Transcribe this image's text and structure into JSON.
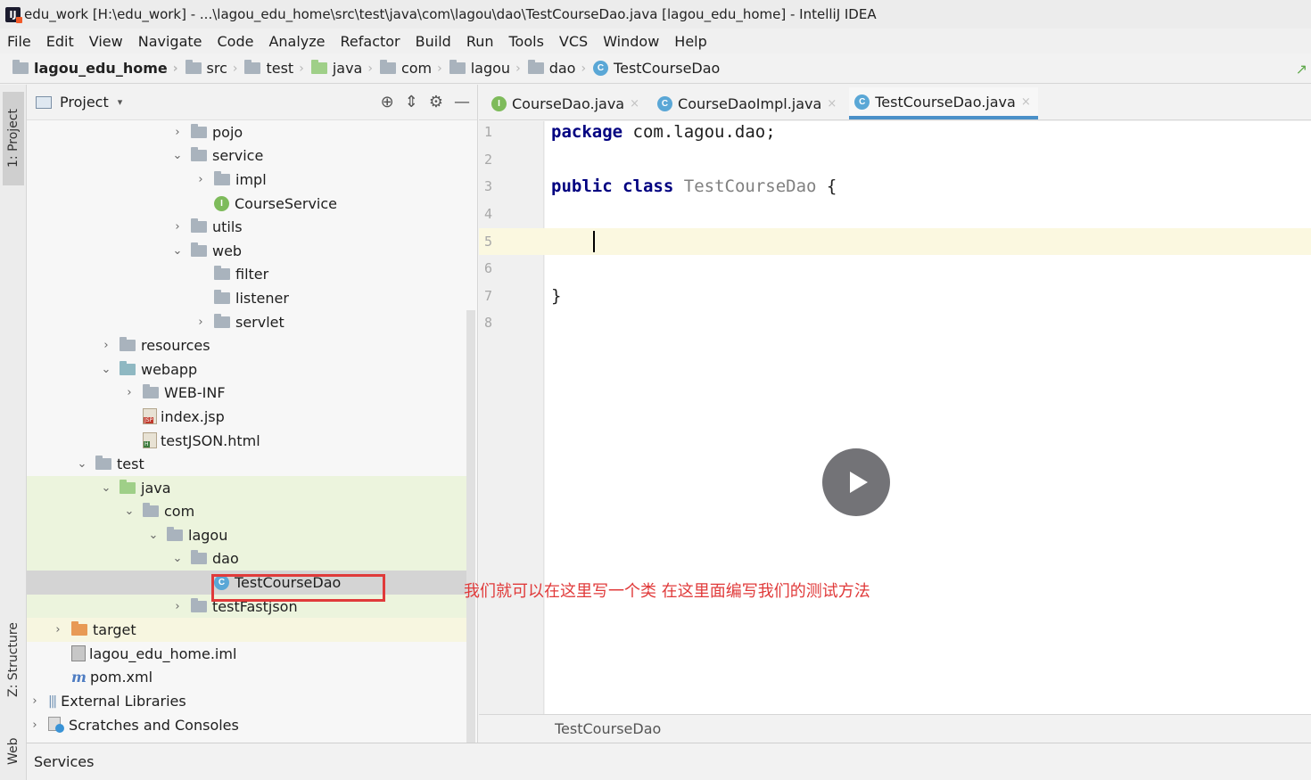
{
  "window": {
    "title": "edu_work [H:\\edu_work] - ...\\lagou_edu_home\\src\\test\\java\\com\\lagou\\dao\\TestCourseDao.java [lagou_edu_home] - IntelliJ IDEA",
    "app_icon_label": "IJ"
  },
  "menu": [
    "File",
    "Edit",
    "View",
    "Navigate",
    "Code",
    "Analyze",
    "Refactor",
    "Build",
    "Run",
    "Tools",
    "VCS",
    "Window",
    "Help"
  ],
  "breadcrumb": [
    "lagou_edu_home",
    "src",
    "test",
    "java",
    "com",
    "lagou",
    "dao",
    "TestCourseDao"
  ],
  "left_strip": {
    "project": "1: Project",
    "structure": "Z: Structure",
    "web": "Web"
  },
  "project_panel": {
    "title": "Project",
    "caret": "▾"
  },
  "tree": [
    {
      "label": "pojo",
      "arrow": "›",
      "icon": "folder"
    },
    {
      "label": "service",
      "arrow": "⌄",
      "icon": "folder"
    },
    {
      "label": "impl",
      "arrow": "›",
      "icon": "folder"
    },
    {
      "label": "CourseService",
      "arrow": "",
      "icon": "interface"
    },
    {
      "label": "utils",
      "arrow": "›",
      "icon": "folder"
    },
    {
      "label": "web",
      "arrow": "⌄",
      "icon": "folder"
    },
    {
      "label": "filter",
      "arrow": "",
      "icon": "folder"
    },
    {
      "label": "listener",
      "arrow": "",
      "icon": "folder"
    },
    {
      "label": "servlet",
      "arrow": "›",
      "icon": "folder"
    },
    {
      "label": "resources",
      "arrow": "›",
      "icon": "folder"
    },
    {
      "label": "webapp",
      "arrow": "⌄",
      "icon": "folder-teal"
    },
    {
      "label": "WEB-INF",
      "arrow": "›",
      "icon": "folder"
    },
    {
      "label": "index.jsp",
      "arrow": "",
      "icon": "jsp"
    },
    {
      "label": "testJSON.html",
      "arrow": "",
      "icon": "html"
    },
    {
      "label": "test",
      "arrow": "⌄",
      "icon": "folder"
    },
    {
      "label": "java",
      "arrow": "⌄",
      "icon": "folder-green"
    },
    {
      "label": "com",
      "arrow": "⌄",
      "icon": "folder"
    },
    {
      "label": "lagou",
      "arrow": "⌄",
      "icon": "folder"
    },
    {
      "label": "dao",
      "arrow": "⌄",
      "icon": "folder"
    },
    {
      "label": "TestCourseDao",
      "arrow": "",
      "icon": "class"
    },
    {
      "label": "testFastjson",
      "arrow": "›",
      "icon": "folder"
    },
    {
      "label": "target",
      "arrow": "›",
      "icon": "folder-orange"
    },
    {
      "label": "lagou_edu_home.iml",
      "arrow": "",
      "icon": "iml"
    },
    {
      "label": "pom.xml",
      "arrow": "",
      "icon": "pom"
    },
    {
      "label": "External Libraries",
      "arrow": "›",
      "icon": "lib"
    },
    {
      "label": "Scratches and Consoles",
      "arrow": "›",
      "icon": "scratch"
    }
  ],
  "editor": {
    "tabs": [
      {
        "label": "CourseDao.java",
        "kind": "interface",
        "close": "×"
      },
      {
        "label": "CourseDaoImpl.java",
        "kind": "class",
        "close": "×"
      },
      {
        "label": "TestCourseDao.java",
        "kind": "class",
        "close": "×"
      }
    ],
    "line_numbers": [
      "1",
      "2",
      "3",
      "4",
      "5",
      "6",
      "7",
      "8"
    ],
    "code": {
      "l1_kw": "package",
      "l1_rest": " com.lagou.dao;",
      "l3_kw1": "public",
      "l3_kw2": "class",
      "l3_name": "TestCourseDao",
      "l3_brace": " {",
      "l7": "}"
    },
    "footer": "TestCourseDao"
  },
  "annotation": "我们就可以在这里写一个类  在这里面编写我们的测试方法",
  "services": "Services",
  "colors": {
    "annotation_red": "#e03a3a",
    "keyword": "#000080",
    "tab_accent": "#4a90c8"
  }
}
